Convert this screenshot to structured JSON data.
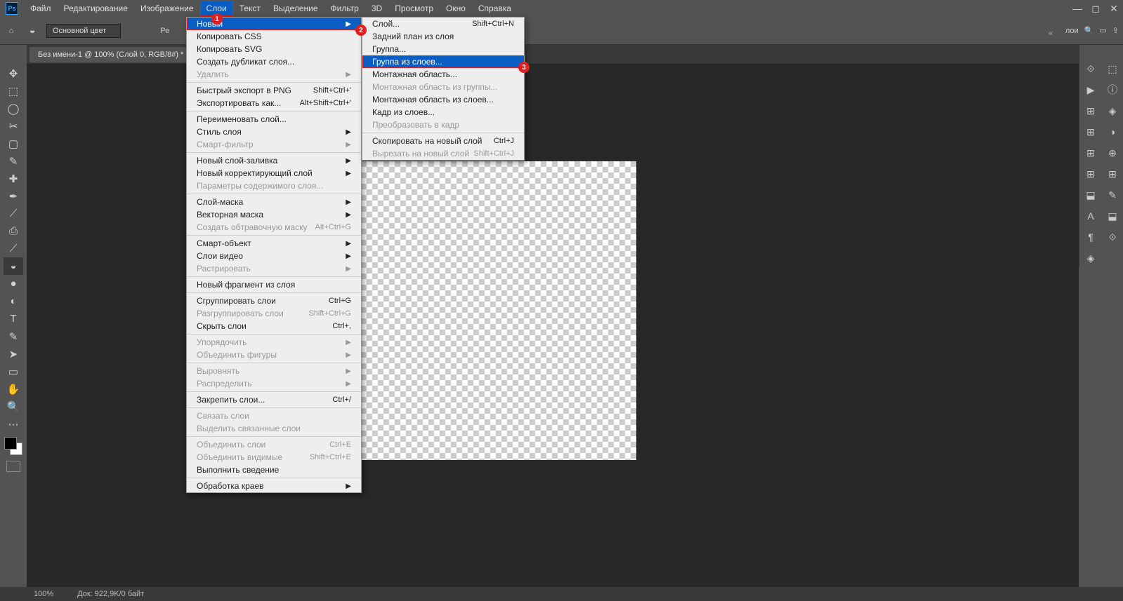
{
  "menubar": [
    "Файл",
    "Редактирование",
    "Изображение",
    "Слои",
    "Текст",
    "Выделение",
    "Фильтр",
    "3D",
    "Просмотр",
    "Окно",
    "Справка"
  ],
  "hl_menubar_index": 3,
  "optbar": {
    "fill_label": "Основной цвет",
    "mode_truncated": "Ре",
    "share_text": "лои"
  },
  "tab": "Без имени-1 @ 100% (Слой 0, RGB/8#) *",
  "menu1": [
    {
      "t": "Новый",
      "a": 1,
      "hl": 1
    },
    {
      "t": "Копировать CSS"
    },
    {
      "t": "Копировать SVG"
    },
    {
      "t": "Создать дубликат слоя..."
    },
    {
      "t": "Удалить",
      "a": 1,
      "d": 1
    },
    {
      "sep": 1
    },
    {
      "t": "Быстрый экспорт в PNG",
      "s": "Shift+Ctrl+'"
    },
    {
      "t": "Экспортировать как...",
      "s": "Alt+Shift+Ctrl+'"
    },
    {
      "sep": 1
    },
    {
      "t": "Переименовать слой..."
    },
    {
      "t": "Стиль слоя",
      "a": 1
    },
    {
      "t": "Смарт-фильтр",
      "a": 1,
      "d": 1
    },
    {
      "sep": 1
    },
    {
      "t": "Новый слой-заливка",
      "a": 1
    },
    {
      "t": "Новый корректирующий слой",
      "a": 1
    },
    {
      "t": "Параметры содержимого слоя...",
      "d": 1
    },
    {
      "sep": 1
    },
    {
      "t": "Слой-маска",
      "a": 1
    },
    {
      "t": "Векторная маска",
      "a": 1
    },
    {
      "t": "Создать обтравочную маску",
      "s": "Alt+Ctrl+G",
      "d": 1
    },
    {
      "sep": 1
    },
    {
      "t": "Смарт-объект",
      "a": 1
    },
    {
      "t": "Слои видео",
      "a": 1
    },
    {
      "t": "Растрировать",
      "a": 1,
      "d": 1
    },
    {
      "sep": 1
    },
    {
      "t": "Новый фрагмент из слоя"
    },
    {
      "sep": 1
    },
    {
      "t": "Сгруппировать слои",
      "s": "Ctrl+G"
    },
    {
      "t": "Разгруппировать слои",
      "s": "Shift+Ctrl+G",
      "d": 1
    },
    {
      "t": "Скрыть слои",
      "s": "Ctrl+,"
    },
    {
      "sep": 1
    },
    {
      "t": "Упорядочить",
      "a": 1,
      "d": 1
    },
    {
      "t": "Объединить фигуры",
      "a": 1,
      "d": 1
    },
    {
      "sep": 1
    },
    {
      "t": "Выровнять",
      "a": 1,
      "d": 1
    },
    {
      "t": "Распределить",
      "a": 1,
      "d": 1
    },
    {
      "sep": 1
    },
    {
      "t": "Закрепить слои...",
      "s": "Ctrl+/"
    },
    {
      "sep": 1
    },
    {
      "t": "Связать слои",
      "d": 1
    },
    {
      "t": "Выделить связанные слои",
      "d": 1
    },
    {
      "sep": 1
    },
    {
      "t": "Объединить слои",
      "s": "Ctrl+E",
      "d": 1
    },
    {
      "t": "Объединить видимые",
      "s": "Shift+Ctrl+E",
      "d": 1
    },
    {
      "t": "Выполнить сведение"
    },
    {
      "sep": 1
    },
    {
      "t": "Обработка краев",
      "a": 1
    }
  ],
  "menu2": [
    {
      "t": "Слой...",
      "s": "Shift+Ctrl+N"
    },
    {
      "t": "Задний план из слоя"
    },
    {
      "t": "Группа..."
    },
    {
      "t": "Группа из слоев...",
      "hl": 1
    },
    {
      "t": "Монтажная область..."
    },
    {
      "t": "Монтажная область из группы...",
      "d": 1
    },
    {
      "t": "Монтажная область из слоев..."
    },
    {
      "t": "Кадр из слоев..."
    },
    {
      "t": "Преобразовать в кадр",
      "d": 1
    },
    {
      "sep": 1
    },
    {
      "t": "Скопировать на новый слой",
      "s": "Ctrl+J"
    },
    {
      "t": "Вырезать на новый слой",
      "s": "Shift+Ctrl+J",
      "d": 1
    }
  ],
  "badges": {
    "1": "1",
    "2": "2",
    "3": "3"
  },
  "status": {
    "zoom": "100%",
    "doc": "Док: 922,9K/0 байт"
  },
  "tool_icons": [
    "✥",
    "⬚",
    "◯",
    "✂",
    "▢",
    "✎",
    "✚",
    "✒",
    "⟋",
    "⎙",
    "⟋",
    "◒",
    "●",
    "◐",
    "T",
    "✎",
    "➤",
    "▭",
    "✋",
    "🔍",
    "⋯"
  ],
  "panel_icons_r2": [
    "⟐",
    "▶",
    "⊞",
    "⊞",
    "⊞",
    "⊞",
    "⬓",
    "A",
    "¶",
    "◈"
  ],
  "panel_icons_r": [
    "⬚",
    "ⓘ",
    "◈",
    "◑",
    "⊕",
    "⊞",
    "✎",
    "⬓",
    "⟐"
  ]
}
